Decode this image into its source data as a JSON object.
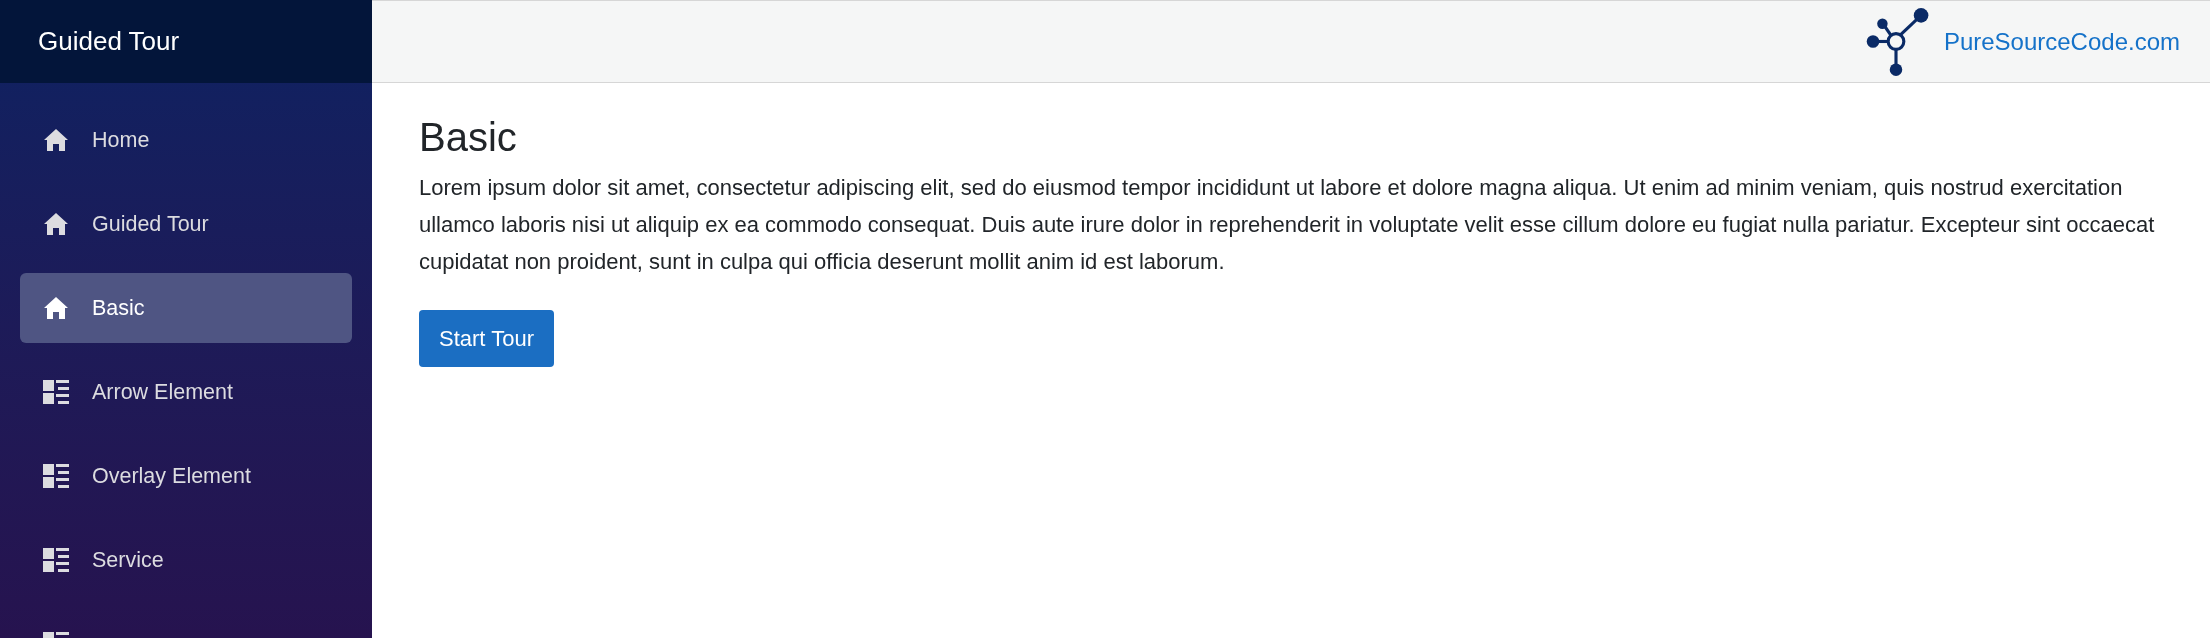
{
  "sidebar": {
    "title": "Guided Tour",
    "items": [
      {
        "label": "Home",
        "kind": "home",
        "selected": false
      },
      {
        "label": "Guided Tour",
        "kind": "home",
        "selected": false
      },
      {
        "label": "Basic",
        "kind": "home",
        "selected": true
      },
      {
        "label": "Arrow Element",
        "kind": "list",
        "selected": false
      },
      {
        "label": "Overlay Element",
        "kind": "list",
        "selected": false
      },
      {
        "label": "Service",
        "kind": "list",
        "selected": false
      },
      {
        "kind": "list",
        "selected": false
      }
    ]
  },
  "top_bar": {
    "brand": "PureSourceCode.com"
  },
  "content": {
    "heading": "Basic",
    "paragraph": "Lorem ipsum dolor sit amet, consectetur adipiscing elit, sed do eiusmod tempor incididunt ut labore et dolore magna aliqua. Ut enim ad minim veniam, quis nostrud exercitation ullamco laboris nisi ut aliquip ex ea commodo consequat. Duis aute irure dolor in reprehenderit in voluptate velit esse cillum dolore eu fugiat nulla pariatur. Excepteur sint occaecat cupidatat non proident, sunt in culpa qui officia deserunt mollit anim id est laborum.",
    "button": "Start Tour"
  }
}
